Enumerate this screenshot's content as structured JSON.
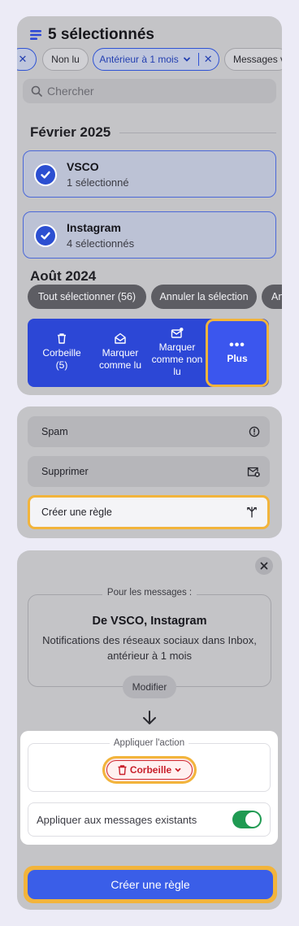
{
  "header": {
    "title": "5 sélectionnés"
  },
  "filters": [
    {
      "label": "Non lu"
    },
    {
      "label": "Antérieur à 1 mois"
    },
    {
      "label": "Messages v"
    }
  ],
  "search": {
    "placeholder": "Chercher"
  },
  "groups": [
    {
      "title": "Février 2025",
      "senders": [
        {
          "name": "VSCO",
          "count": "1 sélectionné"
        },
        {
          "name": "Instagram",
          "count": "4 sélectionnés"
        }
      ]
    },
    {
      "title": "Août 2024"
    }
  ],
  "selection_bar": {
    "select_all": "Tout sélectionner (56)",
    "cancel": "Annuler la sélection",
    "more": "An"
  },
  "actions": {
    "trash": "Corbeille\n(5)",
    "mark_read": "Marquer\ncomme lu",
    "mark_unread": "Marquer\ncomme non\nlu",
    "more": "Plus"
  },
  "more_menu": {
    "spam": "Spam",
    "delete": "Supprimer",
    "create_rule": "Créer une règle"
  },
  "rule": {
    "for_messages_label": "Pour les messages :",
    "from": "De VSCO, Instagram",
    "description": "Notifications des réseaux sociaux dans Inbox, antérieur à 1 mois",
    "modify": "Modifier",
    "apply_action_label": "Appliquer l'action",
    "action_value": "Corbeille",
    "apply_existing_label": "Appliquer aux messages existants",
    "apply_existing_on": true,
    "create_button": "Créer une règle"
  },
  "colors": {
    "accent": "#2c47d6",
    "highlight": "#f2b43b",
    "danger": "#c8202b",
    "toggle_on": "#1f9a52"
  }
}
